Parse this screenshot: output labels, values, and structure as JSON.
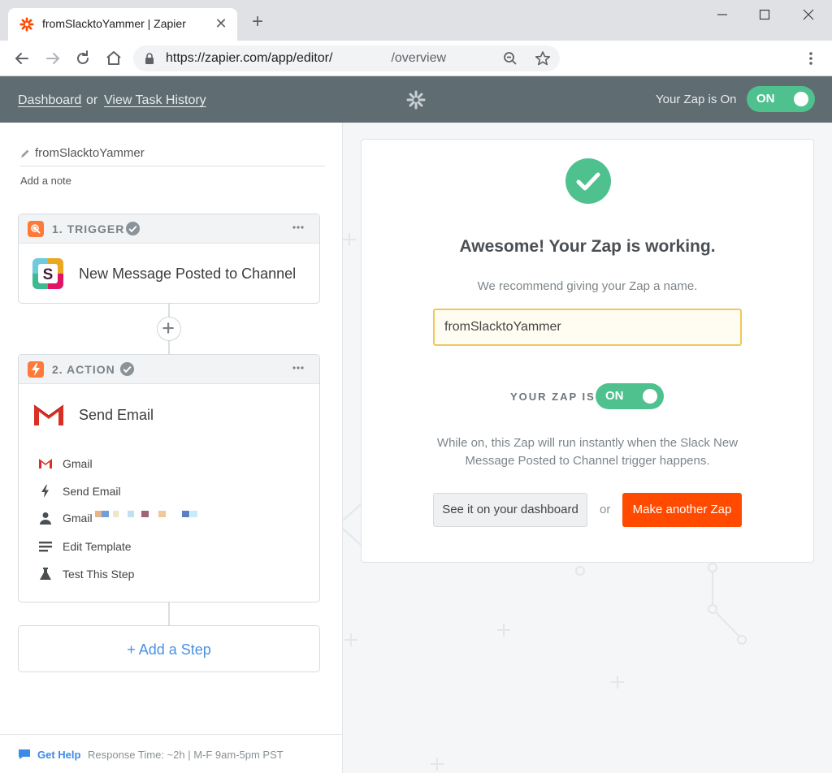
{
  "browser": {
    "tab_title": "fromSlacktoYammer | Zapier",
    "close_glyph": "✕",
    "new_tab_glyph": "+",
    "url_prefix": "https://zapier.com/app/editor/",
    "url_suffix": "/overview"
  },
  "header": {
    "dashboard_link": "Dashboard",
    "or_text": "or",
    "history_link": "View Task History",
    "status_text": "Your Zap is On",
    "toggle_label": "ON"
  },
  "editor": {
    "zap_name": "fromSlacktoYammer",
    "add_note": "Add a note",
    "trigger": {
      "step_label": "1. TRIGGER",
      "title": "New Message Posted to Channel"
    },
    "action": {
      "step_label": "2. ACTION",
      "title": "Send Email",
      "sub_items": [
        {
          "label": "Gmail",
          "icon": "gmail-icon"
        },
        {
          "label": "Send Email",
          "icon": "bolt-icon"
        },
        {
          "label": "Gmail",
          "icon": "user-icon"
        },
        {
          "label": "Edit Template",
          "icon": "lines-icon"
        },
        {
          "label": "Test This Step",
          "icon": "flask-icon"
        }
      ]
    },
    "add_step": "+ Add a Step"
  },
  "help": {
    "get_help": "Get Help",
    "meta": "Response Time: ~2h | M-F 9am-5pm PST"
  },
  "success": {
    "headline": "Awesome! Your Zap is working.",
    "subline": "We recommend giving your Zap a name.",
    "name_value": "fromSlacktoYammer",
    "zap_is_label": "YOUR ZAP IS",
    "toggle_label": "ON",
    "description": "While on, this Zap will run instantly when the Slack New Message Posted to Channel trigger happens.",
    "dashboard_button": "See it on your dashboard",
    "or_text": "or",
    "make_button": "Make another Zap"
  },
  "colors": {
    "header_bg": "#5f6c72",
    "toggle_green": "#4fc18f",
    "brand_orange": "#ff4a00",
    "link_blue": "#4a90e2"
  }
}
